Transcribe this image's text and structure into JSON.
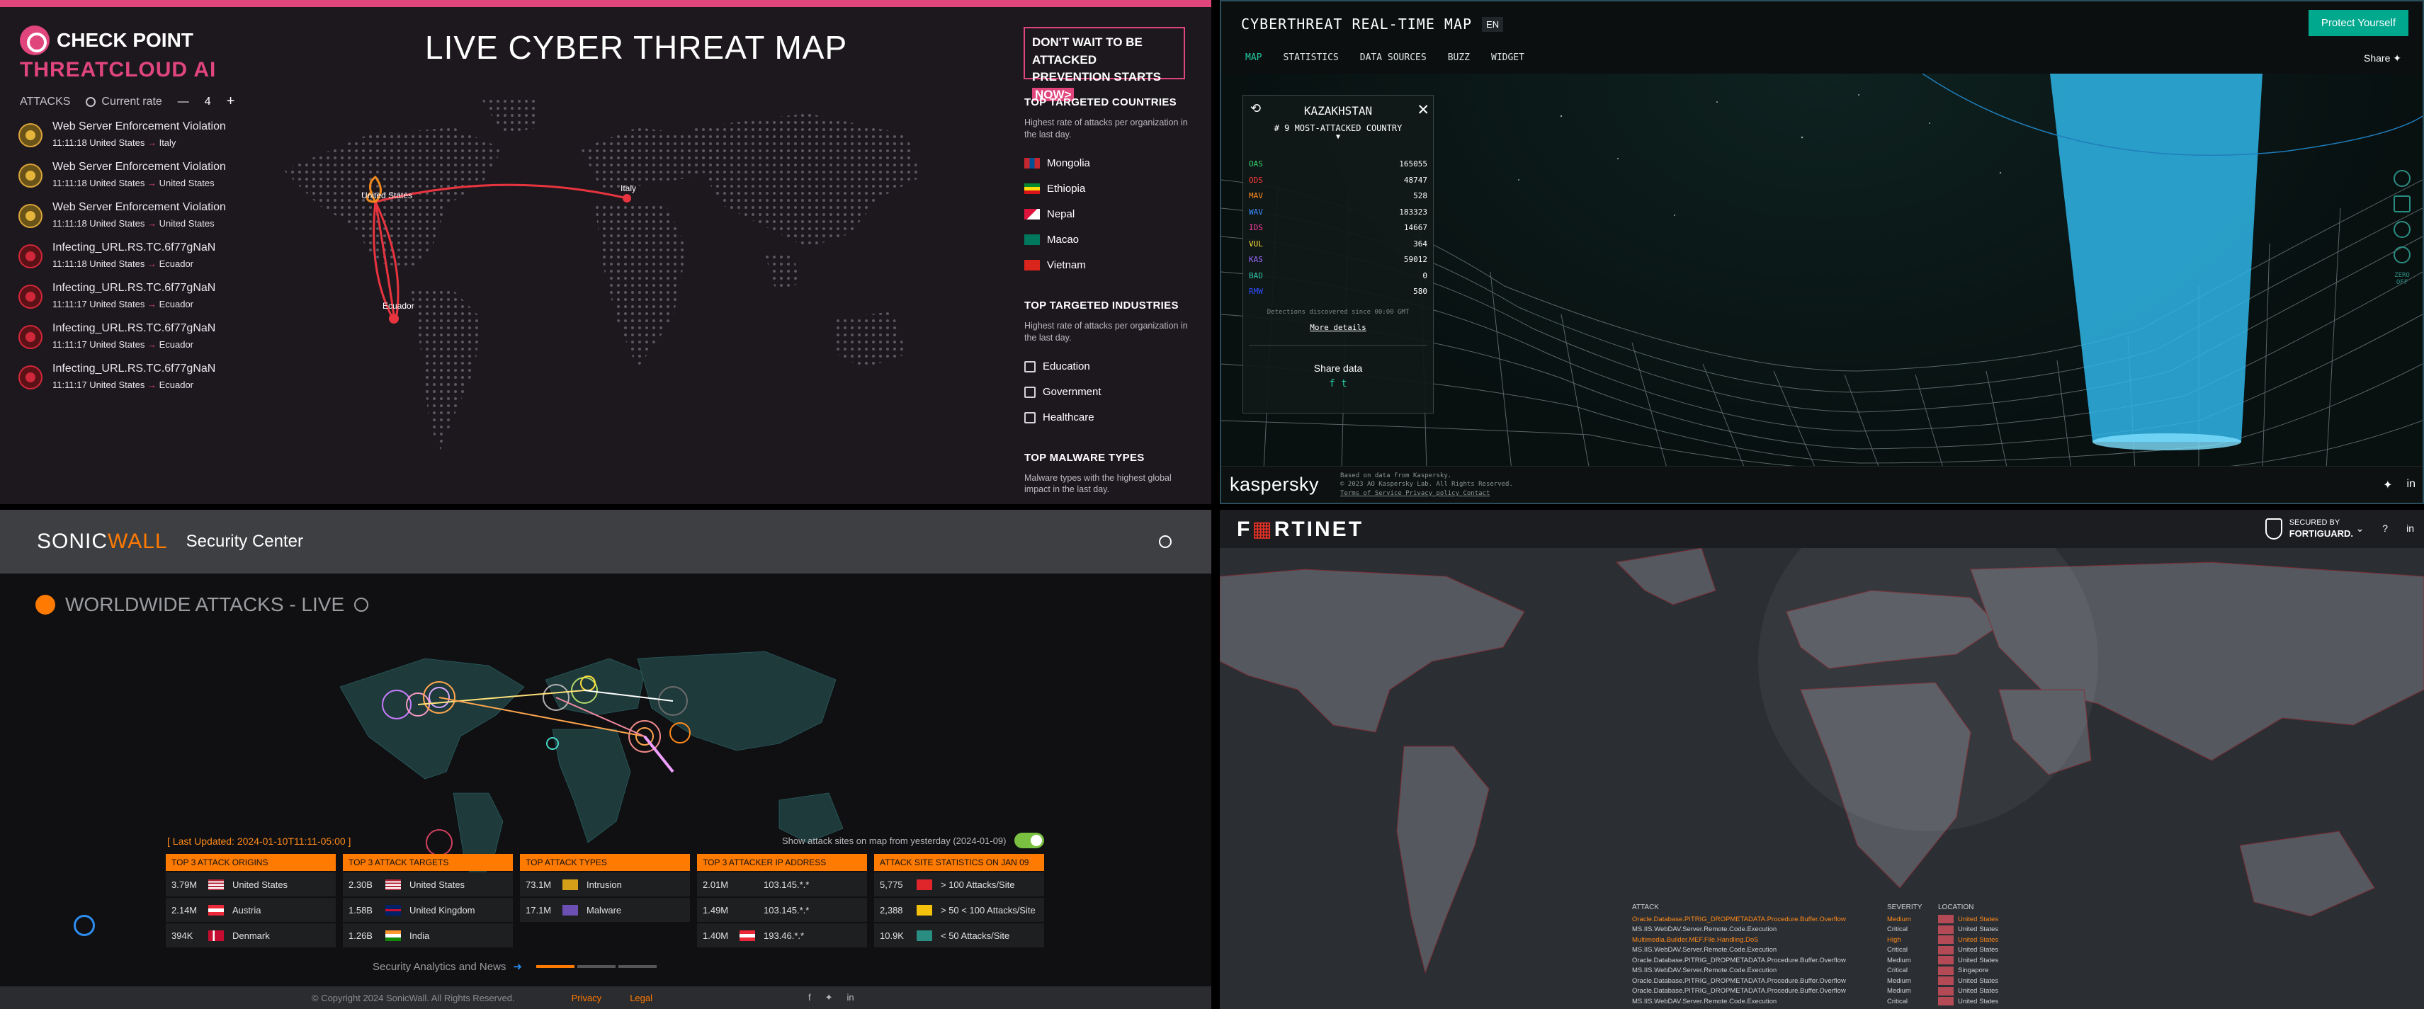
{
  "checkpoint": {
    "brand": "CHECK POINT",
    "sub_brand_a": "THREATCL",
    "sub_brand_b": "UD AI",
    "title": "LIVE CYBER THREAT MAP",
    "promo_line1": "DON'T WAIT TO BE ATTACKED",
    "promo_line2": "PREVENTION STARTS",
    "promo_now": "NOW>",
    "attacks_label": "ATTACKS",
    "rate_label": "Current rate",
    "rate_minus": "—",
    "rate_value": "4",
    "rate_plus": "+",
    "attacks": [
      {
        "title": "Web Server Enforcement Violation",
        "time": "11:11:18",
        "from": "United States",
        "to": "Italy",
        "kind": "web"
      },
      {
        "title": "Web Server Enforcement Violation",
        "time": "11:11:18",
        "from": "United States",
        "to": "United States",
        "kind": "web"
      },
      {
        "title": "Web Server Enforcement Violation",
        "time": "11:11:18",
        "from": "United States",
        "to": "United States",
        "kind": "web"
      },
      {
        "title": "Infecting_URL.RS.TC.6f77gNaN",
        "time": "11:11:18",
        "from": "United States",
        "to": "Ecuador",
        "kind": "mal"
      },
      {
        "title": "Infecting_URL.RS.TC.6f77gNaN",
        "time": "11:11:17",
        "from": "United States",
        "to": "Ecuador",
        "kind": "mal"
      },
      {
        "title": "Infecting_URL.RS.TC.6f77gNaN",
        "time": "11:11:17",
        "from": "United States",
        "to": "Ecuador",
        "kind": "mal"
      },
      {
        "title": "Infecting_URL.RS.TC.6f77gNaN",
        "time": "11:11:17",
        "from": "United States",
        "to": "Ecuador",
        "kind": "mal"
      }
    ],
    "map_labels": {
      "us": "United States",
      "italy": "Italy",
      "ecuador": "Ecuador"
    },
    "top_countries": {
      "heading": "TOP TARGETED COUNTRIES",
      "desc": "Highest rate of attacks per organization in the last day.",
      "items": [
        "Mongolia",
        "Ethiopia",
        "Nepal",
        "Macao",
        "Vietnam"
      ]
    },
    "top_industries": {
      "heading": "TOP TARGETED INDUSTRIES",
      "desc": "Highest rate of attacks per organization in the last day.",
      "items": [
        "Education",
        "Government",
        "Healthcare"
      ]
    },
    "malware": {
      "heading": "TOP MALWARE TYPES",
      "desc": "Malware types with the highest global impact in the last day."
    },
    "accent": "#e0457b"
  },
  "kaspersky": {
    "title": "CYBERTHREAT REAL-TIME MAP",
    "lang": "EN",
    "protect_button": "Protect Yourself",
    "nav": [
      "MAP",
      "STATISTICS",
      "DATA SOURCES",
      "BUZZ",
      "WIDGET"
    ],
    "share": "Share",
    "country_card": {
      "country": "KAZAKHSTAN",
      "rank_text": "# 9 MOST-ATTACKED COUNTRY",
      "rows": [
        {
          "k": "OAS",
          "v": "165055",
          "color": "#32d96b"
        },
        {
          "k": "ODS",
          "v": "48747",
          "color": "#ff3b3b"
        },
        {
          "k": "MAV",
          "v": "528",
          "color": "#ff8d1f"
        },
        {
          "k": "WAV",
          "v": "183323",
          "color": "#3a8cff"
        },
        {
          "k": "IDS",
          "v": "14667",
          "color": "#ff3fa4"
        },
        {
          "k": "VUL",
          "v": "364",
          "color": "#ffe03a"
        },
        {
          "k": "KAS",
          "v": "59012",
          "color": "#9b6cff"
        },
        {
          "k": "BAD",
          "v": "0",
          "color": "#2fc7a6"
        },
        {
          "k": "RMW",
          "v": "580",
          "color": "#2e4dff"
        }
      ],
      "note": "Detections discovered since 00:00 GMT",
      "more": "More details",
      "share_data": "Share data",
      "social": "f  t"
    },
    "legend": [
      {
        "k": "OAS",
        "color": "#32d96b"
      },
      {
        "k": "ODS",
        "color": "#ff3b3b"
      },
      {
        "k": "MAV",
        "color": "#ff8d1f"
      },
      {
        "k": "WAV",
        "color": "#3a8cff"
      },
      {
        "k": "IDS",
        "color": "#ff3fa4"
      },
      {
        "k": "VUL",
        "color": "#ffe03a"
      },
      {
        "k": "KAS",
        "color": "#9b6cff"
      },
      {
        "k": "BAD",
        "color": "#2fc7a6"
      },
      {
        "k": "RMW",
        "color": "#2e4dff"
      }
    ],
    "side_tool": "ZERO OFF",
    "footer_logo": "kaspersky",
    "footer_info_1": "Based on data from Kaspersky.",
    "footer_info_2": "© 2023 AO Kaspersky Lab. All Rights Reserved.",
    "footer_info_3": "Terms of Service Privacy policy Contact"
  },
  "sonicwall": {
    "logo_a": "SONIC",
    "logo_b": "WALL",
    "security_center": "Security Center",
    "heading": "WORLDWIDE ATTACKS - LIVE",
    "last_updated": "[ Last Updated: 2024-01-10T11:11-05:00 ]",
    "toggle_label": "Show attack sites on map from yesterday (2024-01-09)",
    "tables": [
      {
        "header": "TOP 3 ATTACK ORIGINS",
        "rows": [
          {
            "v": "3.79M",
            "label": "United States",
            "flag": "us"
          },
          {
            "v": "2.14M",
            "label": "Austria",
            "flag": "at"
          },
          {
            "v": "394K",
            "label": "Denmark",
            "flag": "dk"
          }
        ]
      },
      {
        "header": "TOP 3 ATTACK TARGETS",
        "rows": [
          {
            "v": "2.30B",
            "label": "United States",
            "flag": "us"
          },
          {
            "v": "1.58B",
            "label": "United Kingdom",
            "flag": "uk"
          },
          {
            "v": "1.26B",
            "label": "India",
            "flag": "in"
          }
        ]
      },
      {
        "header": "TOP ATTACK TYPES",
        "rows": [
          {
            "v": "73.1M",
            "label": "Intrusion",
            "flag": "intr"
          },
          {
            "v": "17.1M",
            "label": "Malware",
            "flag": "mal"
          }
        ]
      },
      {
        "header": "TOP 3 ATTACKER IP ADDRESS",
        "rows": [
          {
            "v": "2.01M",
            "label": "103.145.*.*",
            "flag": "none"
          },
          {
            "v": "1.49M",
            "label": "103.145.*.*",
            "flag": "none"
          },
          {
            "v": "1.40M",
            "label": "193.46.*.*",
            "flag": "at"
          }
        ]
      },
      {
        "header": "ATTACK SITE STATISTICS ON JAN 09",
        "rows": [
          {
            "v": "5,775",
            "label": "> 100 Attacks/Site",
            "flag": "red"
          },
          {
            "v": "2,388",
            "label": "> 50 < 100 Attacks/Site",
            "flag": "yellow"
          },
          {
            "v": "10.9K",
            "label": "< 50 Attacks/Site",
            "flag": "teal"
          }
        ]
      }
    ],
    "news": "Security Analytics and News",
    "copyright": "© Copyright 2024 SonicWall. All Rights Reserved.",
    "privacy": "Privacy",
    "legal": "Legal",
    "accent": "#ff7a00"
  },
  "fortinet": {
    "logo_a": "F",
    "logo_b": "RTINET",
    "secured_by": "SECURED BY",
    "fortiguard": "FORTIGUARD.",
    "headers": {
      "attack": "ATTACK",
      "severity": "SEVERITY",
      "location": "LOCATION"
    },
    "rows": [
      {
        "attack": "Oracle.Database.PITRIG_DROPMETADATA.Procedure.Buffer.Overflow",
        "severity": "Medium",
        "location": "United States",
        "hl": true
      },
      {
        "attack": "MS.IIS.WebDAV.Server.Remote.Code.Execution",
        "severity": "Critical",
        "location": "United States",
        "hl": false
      },
      {
        "attack": "Multimedia.Builder.MEF.File.Handling.DoS",
        "severity": "High",
        "location": "United States",
        "hl": true
      },
      {
        "attack": "MS.IIS.WebDAV.Server.Remote.Code.Execution",
        "severity": "Critical",
        "location": "United States",
        "hl": false
      },
      {
        "attack": "Oracle.Database.PITRIG_DROPMETADATA.Procedure.Buffer.Overflow",
        "severity": "Medium",
        "location": "United States",
        "hl": false
      },
      {
        "attack": "MS.IIS.WebDAV.Server.Remote.Code.Execution",
        "severity": "Critical",
        "location": "Singapore",
        "hl": false
      },
      {
        "attack": "Oracle.Database.PITRIG_DROPMETADATA.Procedure.Buffer.Overflow",
        "severity": "Medium",
        "location": "United States",
        "hl": false
      },
      {
        "attack": "Oracle.Database.PITRIG_DROPMETADATA.Procedure.Buffer.Overflow",
        "severity": "Medium",
        "location": "United States",
        "hl": false
      },
      {
        "attack": "MS.IIS.WebDAV.Server.Remote.Code.Execution",
        "severity": "Critical",
        "location": "United States",
        "hl": false
      }
    ],
    "accent": "#ee3124"
  }
}
